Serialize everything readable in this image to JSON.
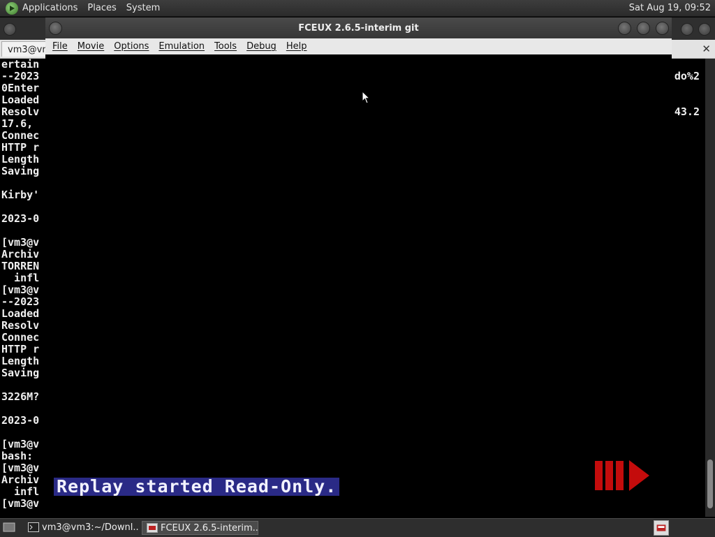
{
  "top_panel": {
    "menus": [
      "Applications",
      "Places",
      "System"
    ],
    "clock": "Sat Aug 19, 09:52"
  },
  "terminal": {
    "tab_label": "vm3@vm",
    "lines": [
      "ertain",
      "--2023",
      "0Enter",
      "Loaded",
      "Resolv",
      "17.6, ",
      "Connec",
      "HTTP r",
      "Length",
      "Saving",
      "",
      "Kirby'",
      "",
      "2023-0",
      "",
      "[vm3@v",
      "Archiv",
      "TORREN",
      "  infl",
      "[vm3@v",
      "--2023",
      "Loaded",
      "Resolv",
      "Connec",
      "HTTP r",
      "Length",
      "Saving",
      "",
      "3226M?",
      "",
      "2023-0",
      "",
      "[vm3@v",
      "bash: ",
      "[vm3@v",
      "Archiv",
      "  infl",
      "[vm3@v"
    ],
    "right_fragment_1": "do%2",
    "right_fragment_2": "43.2"
  },
  "fceux": {
    "title": "FCEUX 2.6.5-interim git",
    "menu": [
      "File",
      "Movie",
      "Options",
      "Emulation",
      "Tools",
      "Debug",
      "Help"
    ],
    "status_message": "Replay started Read-Only.",
    "status_bg": "#2a2a86",
    "indicator_color": "#c40c0c"
  },
  "taskbar": {
    "items": [
      "vm3@vm3:~/Downl...",
      "FCEUX 2.6.5-interim..."
    ]
  }
}
